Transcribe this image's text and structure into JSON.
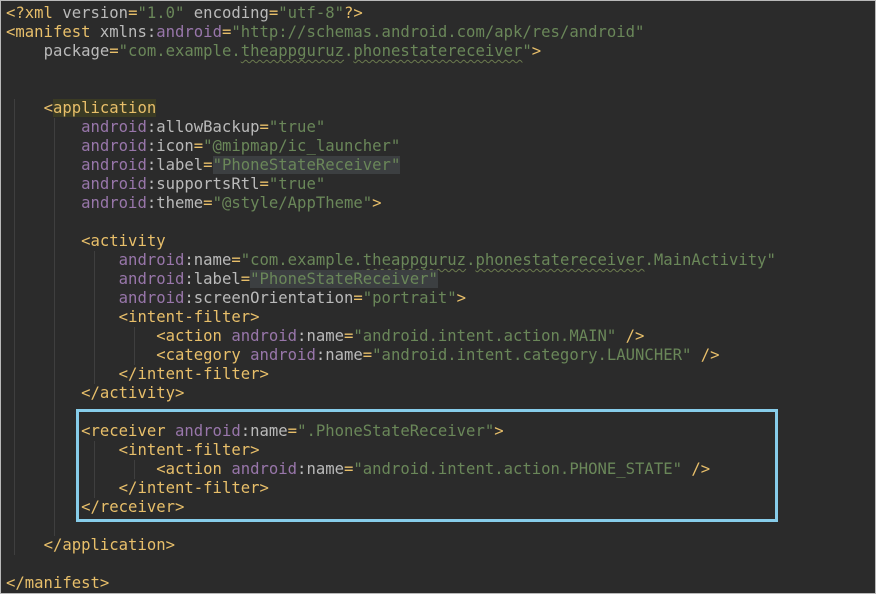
{
  "editor": {
    "language": "xml",
    "file_lines": [
      [
        [
          "t-punc",
          "<?"
        ],
        [
          "t-tag",
          "xml "
        ],
        [
          "t-attr",
          "version"
        ],
        [
          "t-punc",
          "="
        ],
        [
          "t-str",
          "\"1.0\""
        ],
        [
          "t-attr",
          " encoding"
        ],
        [
          "t-punc",
          "="
        ],
        [
          "t-str",
          "\"utf-8\""
        ],
        [
          "t-punc",
          "?>"
        ]
      ],
      [
        [
          "t-punc",
          "<"
        ],
        [
          "t-tag",
          "manifest "
        ],
        [
          "t-attr",
          "xmlns"
        ],
        [
          "t-colon",
          ":"
        ],
        [
          "t-ns",
          "android"
        ],
        [
          "t-punc",
          "="
        ],
        [
          "t-str",
          "\"http://schemas.android.com/apk/res/android\""
        ]
      ],
      [
        [
          "t-text",
          "    "
        ],
        [
          "t-attr",
          "package"
        ],
        [
          "t-punc",
          "="
        ],
        [
          "t-str",
          "\"com.example."
        ],
        [
          "t-str squig",
          "theappguruz"
        ],
        [
          "t-str",
          "."
        ],
        [
          "t-str squig",
          "phonestatereceiver"
        ],
        [
          "t-str",
          "\""
        ],
        [
          "t-punc",
          ">"
        ]
      ],
      [],
      [],
      [
        [
          "t-text",
          "    "
        ],
        [
          "t-punc",
          "<"
        ],
        [
          "t-tag hl-app",
          "application"
        ]
      ],
      [
        [
          "t-text",
          "        "
        ],
        [
          "t-ns",
          "android"
        ],
        [
          "t-colon",
          ":"
        ],
        [
          "t-attr",
          "allowBackup"
        ],
        [
          "t-punc",
          "="
        ],
        [
          "t-str",
          "\"true\""
        ]
      ],
      [
        [
          "t-text",
          "        "
        ],
        [
          "t-ns",
          "android"
        ],
        [
          "t-colon",
          ":"
        ],
        [
          "t-attr",
          "icon"
        ],
        [
          "t-punc",
          "="
        ],
        [
          "t-str",
          "\"@mipmap/ic_launcher\""
        ]
      ],
      [
        [
          "t-text",
          "        "
        ],
        [
          "t-ns",
          "android"
        ],
        [
          "t-colon",
          ":"
        ],
        [
          "t-attr",
          "label"
        ],
        [
          "t-punc",
          "="
        ],
        [
          "t-str hl-label",
          "\"PhoneStateReceiver\""
        ]
      ],
      [
        [
          "t-text",
          "        "
        ],
        [
          "t-ns",
          "android"
        ],
        [
          "t-colon",
          ":"
        ],
        [
          "t-attr",
          "supportsRtl"
        ],
        [
          "t-punc",
          "="
        ],
        [
          "t-str",
          "\"true\""
        ]
      ],
      [
        [
          "t-text",
          "        "
        ],
        [
          "t-ns",
          "android"
        ],
        [
          "t-colon",
          ":"
        ],
        [
          "t-attr",
          "theme"
        ],
        [
          "t-punc",
          "="
        ],
        [
          "t-str",
          "\"@style/AppTheme\""
        ],
        [
          "t-punc",
          ">"
        ]
      ],
      [],
      [
        [
          "t-text",
          "        "
        ],
        [
          "t-punc",
          "<"
        ],
        [
          "t-tag",
          "activity"
        ]
      ],
      [
        [
          "t-text",
          "            "
        ],
        [
          "t-ns",
          "android"
        ],
        [
          "t-colon",
          ":"
        ],
        [
          "t-attr",
          "name"
        ],
        [
          "t-punc",
          "="
        ],
        [
          "t-str",
          "\"com.example."
        ],
        [
          "t-str squig",
          "theappguruz"
        ],
        [
          "t-str",
          "."
        ],
        [
          "t-str squig",
          "phonestatereceiver"
        ],
        [
          "t-str",
          ".MainActivity\""
        ]
      ],
      [
        [
          "t-text",
          "            "
        ],
        [
          "t-ns",
          "android"
        ],
        [
          "t-colon",
          ":"
        ],
        [
          "t-attr",
          "label"
        ],
        [
          "t-punc",
          "="
        ],
        [
          "t-str hl-label",
          "\"PhoneStateReceiver\""
        ]
      ],
      [
        [
          "t-text",
          "            "
        ],
        [
          "t-ns",
          "android"
        ],
        [
          "t-colon",
          ":"
        ],
        [
          "t-attr",
          "screenOrientation"
        ],
        [
          "t-punc",
          "="
        ],
        [
          "t-str",
          "\"portrait\""
        ],
        [
          "t-punc",
          ">"
        ]
      ],
      [
        [
          "t-text",
          "            "
        ],
        [
          "t-punc",
          "<"
        ],
        [
          "t-tag",
          "intent-filter"
        ],
        [
          "t-punc",
          ">"
        ]
      ],
      [
        [
          "t-text",
          "                "
        ],
        [
          "t-punc",
          "<"
        ],
        [
          "t-tag",
          "action "
        ],
        [
          "t-ns",
          "android"
        ],
        [
          "t-colon",
          ":"
        ],
        [
          "t-attr",
          "name"
        ],
        [
          "t-punc",
          "="
        ],
        [
          "t-str",
          "\"android.intent.action.MAIN\""
        ],
        [
          "t-punc",
          " />"
        ]
      ],
      [
        [
          "t-text",
          "                "
        ],
        [
          "t-punc",
          "<"
        ],
        [
          "t-tag",
          "category "
        ],
        [
          "t-ns",
          "android"
        ],
        [
          "t-colon",
          ":"
        ],
        [
          "t-attr",
          "name"
        ],
        [
          "t-punc",
          "="
        ],
        [
          "t-str",
          "\"android.intent.category.LAUNCHER\""
        ],
        [
          "t-punc",
          " />"
        ]
      ],
      [
        [
          "t-text",
          "            "
        ],
        [
          "t-punc",
          "</"
        ],
        [
          "t-tag",
          "intent-filter"
        ],
        [
          "t-punc",
          ">"
        ]
      ],
      [
        [
          "t-text",
          "        "
        ],
        [
          "t-punc",
          "</"
        ],
        [
          "t-tag",
          "activity"
        ],
        [
          "t-punc",
          ">"
        ]
      ],
      [],
      [
        [
          "t-text",
          "        "
        ],
        [
          "t-punc",
          "<"
        ],
        [
          "t-tag",
          "receiver "
        ],
        [
          "t-ns",
          "android"
        ],
        [
          "t-colon",
          ":"
        ],
        [
          "t-attr",
          "name"
        ],
        [
          "t-punc",
          "="
        ],
        [
          "t-str",
          "\".PhoneStateReceiver\""
        ],
        [
          "t-punc",
          ">"
        ]
      ],
      [
        [
          "t-text",
          "            "
        ],
        [
          "t-punc",
          "<"
        ],
        [
          "t-tag",
          "intent-filter"
        ],
        [
          "t-punc",
          ">"
        ]
      ],
      [
        [
          "t-text",
          "                "
        ],
        [
          "t-punc",
          "<"
        ],
        [
          "t-tag",
          "action "
        ],
        [
          "t-ns",
          "android"
        ],
        [
          "t-colon",
          ":"
        ],
        [
          "t-attr",
          "name"
        ],
        [
          "t-punc",
          "="
        ],
        [
          "t-str",
          "\"android.intent.action.PHONE_STATE\""
        ],
        [
          "t-punc",
          " />"
        ]
      ],
      [
        [
          "t-text",
          "            "
        ],
        [
          "t-punc",
          "</"
        ],
        [
          "t-tag",
          "intent-filter"
        ],
        [
          "t-punc",
          ">"
        ]
      ],
      [
        [
          "t-text",
          "        "
        ],
        [
          "t-punc",
          "</"
        ],
        [
          "t-tag",
          "receiver"
        ],
        [
          "t-punc",
          ">"
        ]
      ],
      [],
      [
        [
          "t-text",
          "    "
        ],
        [
          "t-punc",
          "</"
        ],
        [
          "t-tag",
          "application"
        ],
        [
          "t-punc",
          ">"
        ]
      ],
      [],
      [
        [
          "t-punc",
          "</"
        ],
        [
          "t-tag",
          "manifest"
        ],
        [
          "t-punc",
          ">"
        ]
      ]
    ]
  },
  "colors": {
    "background": "#2b2b2b",
    "tag": "#e8bf6a",
    "namespace": "#9876aa",
    "attribute": "#bababa",
    "string": "#6a8759",
    "highlight_box": "#87cdea"
  }
}
